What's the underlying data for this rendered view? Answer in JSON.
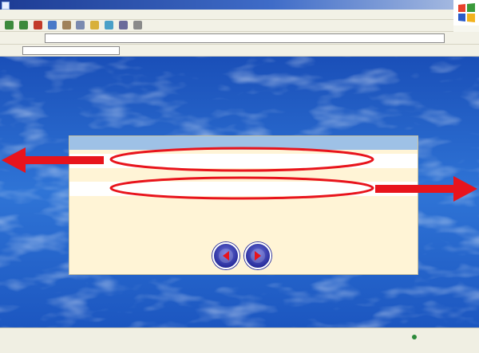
{
  "window": {
    "title": ""
  },
  "menu": [
    "",
    "",
    "",
    "",
    "",
    ""
  ],
  "address": {
    "label": "",
    "url": "",
    "go_label": ""
  },
  "links_bar": {
    "text": ""
  },
  "notice": {
    "heading": "",
    "link_flash": "",
    "link_simple": "",
    "message": ""
  },
  "nav_buttons": [
    {
      "name": "back",
      "icon": "left-arrow-icon"
    },
    {
      "name": "forward",
      "icon": "right-arrow-icon"
    }
  ],
  "status": {
    "left": "",
    "zone": ""
  },
  "colors": {
    "annotation_red": "#e8141c",
    "notice_bg": "#fff4d6",
    "notice_header": "#9ec1e6",
    "link_text": "#6878c8",
    "button_blue": "#2a2f9e"
  }
}
